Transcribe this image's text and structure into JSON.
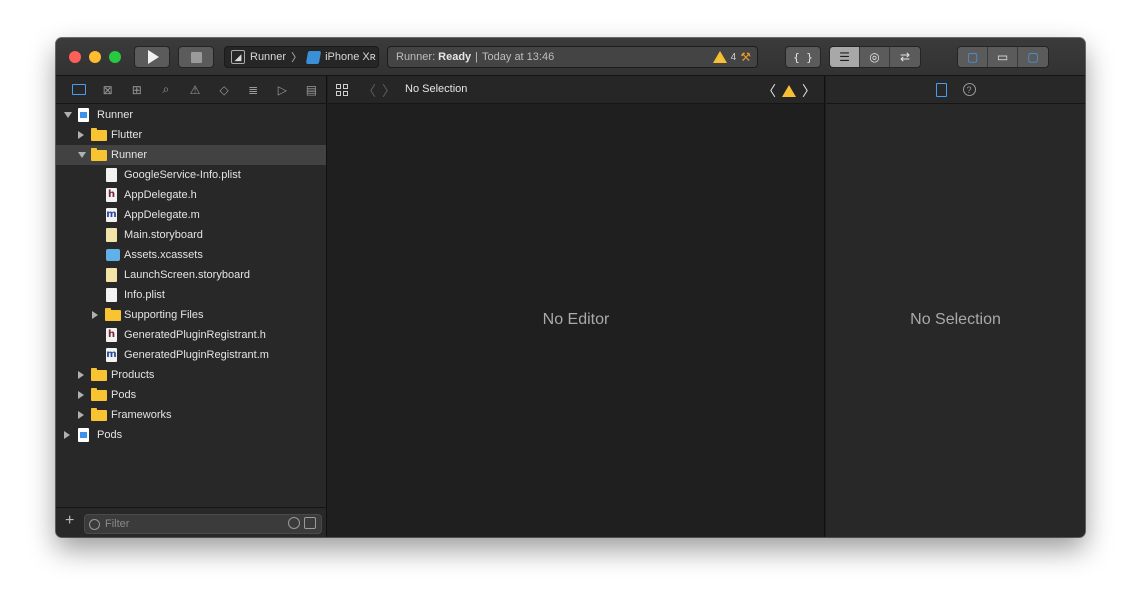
{
  "toolbar": {
    "scheme_name": "Runner",
    "device_name": "iPhone Xʀ",
    "activity_app": "Runner:",
    "activity_status": "Ready",
    "activity_time": "Today at 13:46",
    "warning_count": "4",
    "code_review_label": "{ }"
  },
  "navigator": {
    "items": [
      {
        "label": "Runner",
        "indent": 0,
        "icon": "project-icon",
        "disclosure": "open"
      },
      {
        "label": "Flutter",
        "indent": 1,
        "icon": "folder-icon",
        "disclosure": "closed"
      },
      {
        "label": "Runner",
        "indent": 1,
        "icon": "folder-icon",
        "disclosure": "open",
        "selected": true
      },
      {
        "label": "GoogleService-Info.plist",
        "indent": 2,
        "icon": "plist-icon"
      },
      {
        "label": "AppDelegate.h",
        "indent": 2,
        "icon": "header-file-icon"
      },
      {
        "label": "AppDelegate.m",
        "indent": 2,
        "icon": "objc-file-icon"
      },
      {
        "label": "Main.storyboard",
        "indent": 2,
        "icon": "storyboard-icon"
      },
      {
        "label": "Assets.xcassets",
        "indent": 2,
        "icon": "assets-icon"
      },
      {
        "label": "LaunchScreen.storyboard",
        "indent": 2,
        "icon": "storyboard-icon"
      },
      {
        "label": "Info.plist",
        "indent": 2,
        "icon": "plist-icon"
      },
      {
        "label": "Supporting Files",
        "indent": 2,
        "icon": "folder-icon",
        "disclosure": "closed"
      },
      {
        "label": "GeneratedPluginRegistrant.h",
        "indent": 2,
        "icon": "header-file-icon"
      },
      {
        "label": "GeneratedPluginRegistrant.m",
        "indent": 2,
        "icon": "objc-file-icon"
      },
      {
        "label": "Products",
        "indent": 1,
        "icon": "folder-icon",
        "disclosure": "closed"
      },
      {
        "label": "Pods",
        "indent": 1,
        "icon": "folder-icon",
        "disclosure": "closed"
      },
      {
        "label": "Frameworks",
        "indent": 1,
        "icon": "folder-icon",
        "disclosure": "closed"
      },
      {
        "label": "Pods",
        "indent": 0,
        "icon": "project-icon",
        "disclosure": "closed"
      }
    ],
    "filter_placeholder": "Filter"
  },
  "editor": {
    "jump_title": "No Selection",
    "placeholder": "No Editor"
  },
  "inspector": {
    "placeholder": "No Selection"
  }
}
